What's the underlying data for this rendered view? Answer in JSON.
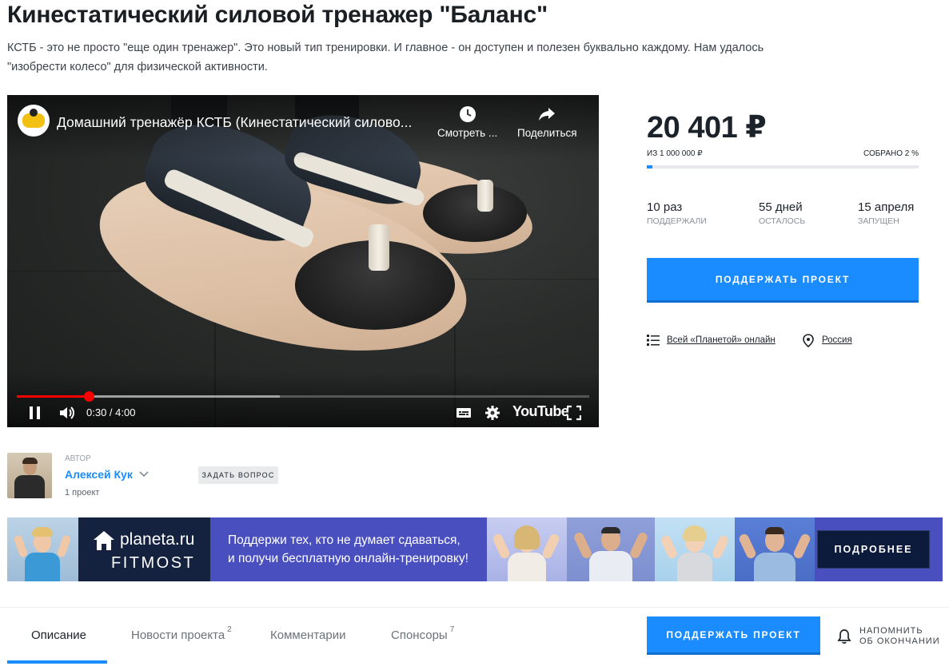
{
  "project": {
    "title": "Кинестатический силовой тренажер \"Баланс\"",
    "lead": "КСТБ - это не просто \"еще один тренажер\". Это новый тип тренировки. И главное - он доступен и полезен буквально каждому. Нам удалось \"изобрести колесо\" для физической активности."
  },
  "video": {
    "title": "Домашний тренажёр КСТБ (Кинестатический силово...",
    "watch_later_label": "Смотреть ...",
    "share_label": "Поделиться",
    "current_time": "0:30",
    "duration": "4:00",
    "time_display": "0:30 / 4:00",
    "progress_fraction": 0.125,
    "buffered_fraction": 0.46,
    "brand": "YouTube",
    "icons": {
      "channel": "channel-logo-icon",
      "watch_later": "clock-icon",
      "share": "share-arrow-icon",
      "pause": "pause-icon",
      "volume": "volume-icon",
      "subtitles": "subtitles-icon",
      "settings": "gear-icon",
      "fullscreen": "fullscreen-icon"
    }
  },
  "funding": {
    "amount": "20 401 ₽",
    "goal": "из 1 000 000 ₽",
    "collected": "собрано 2 %",
    "progress_fraction": 0.02,
    "stats": [
      {
        "value": "10 раз",
        "label": "поддержали"
      },
      {
        "value": "55 дней",
        "label": "осталось"
      },
      {
        "value": "15 апреля",
        "label": "запущен"
      }
    ],
    "support_label": "Поддержать проект",
    "category_link": "Всей «Планетой» онлайн",
    "location_link": "Россия"
  },
  "author": {
    "caption": "Автор",
    "name": "Алексей Кук",
    "projects": "1 проект",
    "ask_label": "Задать вопрос"
  },
  "banner": {
    "brand": "planeta.ru",
    "partner": "FITMOST",
    "text_line1": "Поддержи тех, кто не думает сдаваться,",
    "text_line2": "и получи бесплатную онлайн-тренировку!",
    "button_label": "ПОДРОБНЕЕ"
  },
  "tabs": {
    "items": [
      {
        "label": "Описание",
        "count": ""
      },
      {
        "label": "Новости проекта",
        "count": "2"
      },
      {
        "label": "Комментарии",
        "count": ""
      },
      {
        "label": "Спонсоры",
        "count": "7"
      }
    ],
    "active": "Описание",
    "support_label": "Поддержать проект",
    "remind_line1": "Напомнить",
    "remind_line2": "об окончании"
  },
  "colors": {
    "accent": "#1a8cff",
    "progress_red": "#ff0000",
    "banner_bg": "#4a4fc0",
    "banner_button": "#0c1a3c"
  }
}
